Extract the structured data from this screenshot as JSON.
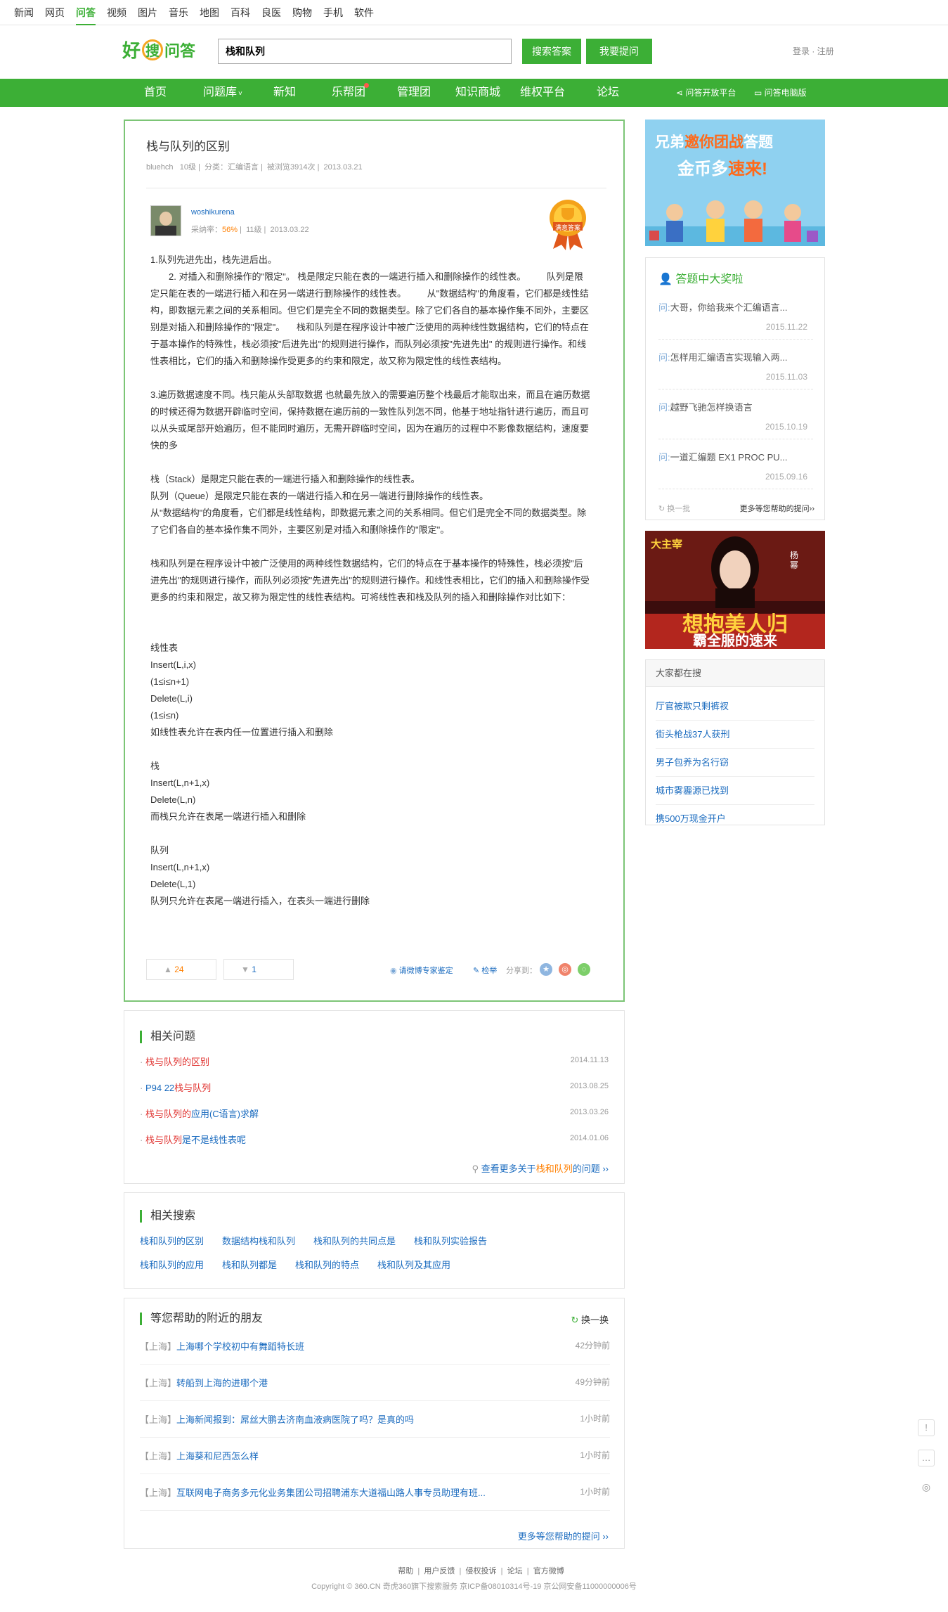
{
  "topnav": [
    "新闻",
    "网页",
    "问答",
    "视频",
    "图片",
    "音乐",
    "地图",
    "百科",
    "良医",
    "购物",
    "手机",
    "软件"
  ],
  "topnav_active": "问答",
  "logo": {
    "hao": "好",
    "sou": "搜",
    "wenda": "问答"
  },
  "search": {
    "value": "栈和队列",
    "btn_search": "搜索答案",
    "btn_ask": "我要提问"
  },
  "login": {
    "login": "登录",
    "sep": "·",
    "register": "注册"
  },
  "mainnav": {
    "items": [
      "首页",
      "问题库",
      "新知",
      "乐帮团",
      "管理团",
      "知识商城",
      "维权平台",
      "论坛"
    ],
    "open": "问答开放平台",
    "pc": "问答电脑版"
  },
  "question": {
    "title": "栈与队列的区别",
    "user": "bluehch",
    "level": "10级",
    "category_label": "分类：",
    "category": "汇编语言",
    "views": "被浏览3914次",
    "date": "2013.03.21"
  },
  "answer": {
    "user": "woshikurena",
    "rate_label": "采纳率：",
    "rate": "56%",
    "level": "11级",
    "date": "2013.03.22",
    "badge": "满意答案",
    "paragraphs": [
      "1.队列先进先出，栈先进后出。",
      "　　2. 对插入和删除操作的\"限定\"。 栈是限定只能在表的一端进行插入和删除操作的线性表。 　　队列是限定只能在表的一端进行插入和在另一端进行删除操作的线性表。 　　从\"数据结构\"的角度看，它们都是线性结构，即数据元素之间的关系相同。但它们是完全不同的数据类型。除了它们各自的基本操作集不同外，主要区别是对插入和删除操作的\"限定\"。 　栈和队列是在程序设计中被广泛使用的两种线性数据结构，它们的特点在于基本操作的特殊性，栈必须按\"后进先出\"的规则进行操作，而队列必须按\"先进先出\" 的规则进行操作。和线性表相比，它们的插入和删除操作受更多的约束和限定，故又称为限定性的线性表结构。",
      "",
      "3.遍历数据速度不同。栈只能从头部取数据 也就最先放入的需要遍历整个栈最后才能取出来，而且在遍历数据的时候还得为数据开辟临时空间，保持数据在遍历前的一致性队列怎不同，他基于地址指针进行遍历，而且可以从头或尾部开始遍历，但不能同时遍历，无需开辟临时空间，因为在遍历的过程中不影像数据结构，速度要快的多",
      "",
      "栈（Stack）是限定只能在表的一端进行插入和删除操作的线性表。",
      "队列（Queue）是限定只能在表的一端进行插入和在另一端进行删除操作的线性表。",
      "从\"数据结构\"的角度看，它们都是线性结构，即数据元素之间的关系相同。但它们是完全不同的数据类型。除了它们各自的基本操作集不同外，主要区别是对插入和删除操作的\"限定\"。",
      "",
      "栈和队列是在程序设计中被广泛使用的两种线性数据结构，它们的特点在于基本操作的特殊性，栈必须按\"后进先出\"的规则进行操作，而队列必须按\"先进先出\"的规则进行操作。和线性表相比，它们的插入和删除操作受更多的约束和限定，故又称为限定性的线性表结构。可将线性表和栈及队列的插入和删除操作对比如下：",
      "",
      "",
      "线性表",
      " Insert(L,i,x)",
      "(1≤i≤n+1)",
      " Delete(L,i)",
      "(1≤i≤n)",
      " 如线性表允许在表内任一位置进行插入和删除",
      "",
      "栈",
      " Insert(L,n+1,x)",
      " Delete(L,n)",
      " 而栈只允许在表尾一端进行插入和删除",
      "",
      "队列",
      " Insert(L,n+1,x)",
      " Delete(L,1)",
      " 队列只允许在表尾一端进行插入，在表头一端进行删除"
    ],
    "likes": "24",
    "dislikes": "1",
    "expert": "请微博专家鉴定",
    "report": "检举",
    "share": "分享到："
  },
  "related_questions": {
    "title": "相关问题",
    "items": [
      {
        "red": "栈与队列的区别",
        "blue": "",
        "date": "2014.11.13"
      },
      {
        "pre": "P94 22",
        "red": "栈与队列",
        "blue": "",
        "date": "2013.08.25"
      },
      {
        "red": "栈与队列的",
        "blue": "应用(C语言)求解",
        "date": "2013.03.26"
      },
      {
        "red": "栈与队列",
        "blue": "是不是线性表呢",
        "date": "2014.01.06"
      }
    ],
    "more_pre": "查看更多关于",
    "more_kw": "栈和队列",
    "more_post": "的问题"
  },
  "related_search": {
    "title": "相关搜索",
    "row1": [
      "栈和队列的区别",
      "数据结构栈和队列",
      "栈和队列的共同点是",
      "栈和队列实验报告"
    ],
    "row2": [
      "栈和队列的应用",
      "栈和队列都是",
      "栈和队列的特点",
      "栈和队列及其应用"
    ]
  },
  "nearby": {
    "title": "等您帮助的附近的朋友",
    "refresh": "换一换",
    "items": [
      {
        "loc": "【上海】",
        "q": "上海哪个学校初中有舞蹈特长班",
        "time": "42分钟前"
      },
      {
        "loc": "【上海】",
        "q": "转船到上海的进哪个港",
        "time": "49分钟前"
      },
      {
        "loc": "【上海】",
        "q": "上海新闻报到：屌丝大鹏去济南血液病医院了吗？是真的吗",
        "time": "1小时前"
      },
      {
        "loc": "【上海】",
        "q": "上海葵和尼西怎么样",
        "time": "1小时前"
      },
      {
        "loc": "【上海】",
        "q": "互联网电子商务多元化业务集团公司招聘浦东大道福山路人事专员助理有班...",
        "time": "1小时前"
      }
    ],
    "more": "更多等您帮助的提问"
  },
  "footer": {
    "links": [
      "帮助",
      "用户反馈",
      "侵权投诉",
      "论坛",
      "官方微博"
    ],
    "copyright": "Copyright © 360.CN 奇虎360旗下搜索服务 京ICP备08010314号-19 京公网安备11000000006号"
  },
  "ad1": {
    "line1a": "兄弟",
    "line1b": "邀你团战",
    "line1c": "答题",
    "line2a": "金币多",
    "line2b": "速来!"
  },
  "prize": {
    "title": "答题中大奖啦",
    "q_label": "问:",
    "items": [
      {
        "q": "大哥，你给我来个汇编语言...",
        "date": "2015.11.22"
      },
      {
        "q": "怎样用汇编语言实现输入两...",
        "date": "2015.11.03"
      },
      {
        "q": "越野飞驰怎样换语言",
        "date": "2015.10.19"
      },
      {
        "q": "一道汇编题 EX1 PROC PU...",
        "date": "2015.09.16"
      }
    ],
    "change": "换一批",
    "more": "更多等您帮助的提问"
  },
  "ad2": {
    "brand": "大主宰",
    "name": "杨 幂",
    "big": "想抱美人归",
    "sub": "霸全服的速来"
  },
  "hot": {
    "title": "大家都在搜",
    "items": [
      "厅官被欺只剩裤衩",
      "街头枪战37人获刑",
      "男子包养为名行窃",
      "城市雾霾源已找到",
      "携500万现金开户"
    ]
  },
  "colors": {
    "green": "#3caf36",
    "red": "#e0302d",
    "blue": "#1a6bbf",
    "orange": "#ff7f00"
  }
}
